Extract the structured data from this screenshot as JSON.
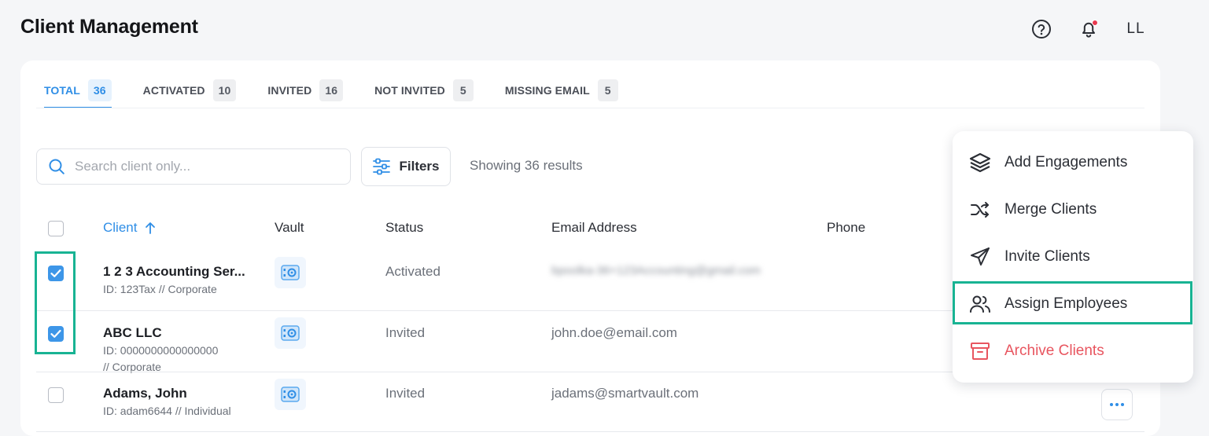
{
  "header": {
    "title": "Client Management",
    "help_icon": "help-circle-icon",
    "notifications_icon": "bell-icon",
    "avatar_initials": "LL"
  },
  "tabs": [
    {
      "label": "TOTAL",
      "count": "36",
      "active": true
    },
    {
      "label": "ACTIVATED",
      "count": "10",
      "active": false
    },
    {
      "label": "INVITED",
      "count": "16",
      "active": false
    },
    {
      "label": "NOT INVITED",
      "count": "5",
      "active": false
    },
    {
      "label": "MISSING EMAIL",
      "count": "5",
      "active": false
    }
  ],
  "toolbar": {
    "search_placeholder": "Search client only...",
    "filters_label": "Filters",
    "results_text": "Showing 36 results"
  },
  "table": {
    "columns": {
      "client": "Client",
      "vault": "Vault",
      "status": "Status",
      "email": "Email Address",
      "phone": "Phone"
    },
    "rows": [
      {
        "name": "1 2 3 Accounting Ser...",
        "id_line1": "ID: 123Tax // Corporate",
        "id_line2": "",
        "status": "Activated",
        "email": "bpoolka-36+123Accounting@gmail.com",
        "checked": true
      },
      {
        "name": "ABC LLC",
        "id_line1": "ID: 0000000000000000",
        "id_line2": "// Corporate",
        "status": "Invited",
        "email": "john.doe@email.com",
        "checked": true
      },
      {
        "name": "Adams, John",
        "id_line1": "ID: adam6644 // Individual",
        "id_line2": "",
        "status": "Invited",
        "email": "jadams@smartvault.com",
        "checked": false
      }
    ]
  },
  "context_menu": {
    "items": [
      {
        "label": "Add Engagements",
        "icon": "layers-icon"
      },
      {
        "label": "Merge Clients",
        "icon": "shuffle-icon"
      },
      {
        "label": "Invite Clients",
        "icon": "send-icon"
      },
      {
        "label": "Assign Employees",
        "icon": "users-icon"
      },
      {
        "label": "Archive Clients",
        "icon": "archive-icon"
      }
    ]
  },
  "colors": {
    "accent": "#2f8ee6",
    "highlight": "#18b393",
    "danger": "#e8555f"
  }
}
